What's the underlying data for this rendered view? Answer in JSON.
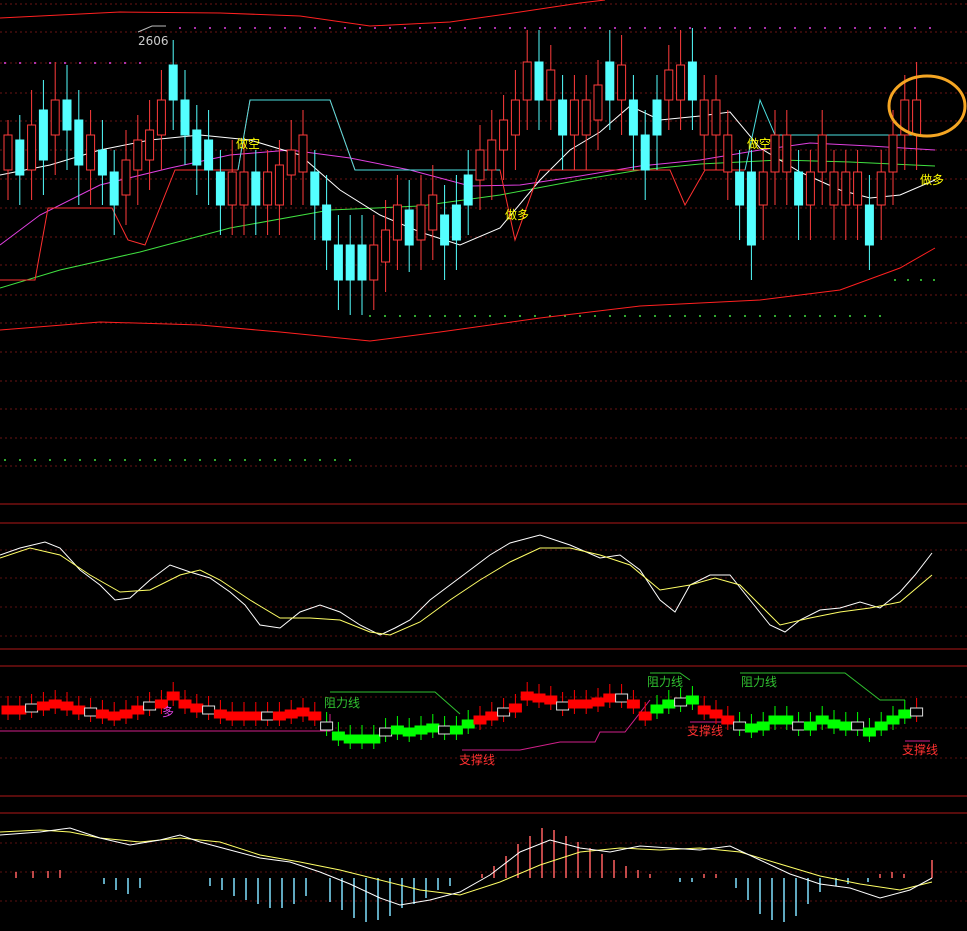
{
  "chart_data": {
    "type": "candlestick",
    "panels": [
      {
        "id": "main",
        "price_label": "2606",
        "annotations": [
          "做空",
          "做多",
          "做空",
          "做多"
        ],
        "colors": {
          "up_candle": "#ff3b3b",
          "down_candle": "#54ffff",
          "ma_white": "#ffffff",
          "ma_magenta": "#e040e0",
          "ma_green": "#40e040",
          "band": "#ff2020",
          "stop_line_red": "#ff3030",
          "stop_line_cyan": "#4de0e0",
          "highlight_circle": "#f5a623",
          "annotation_text": "#ffff00"
        }
      },
      {
        "id": "kdj",
        "series": [
          "fast",
          "slow"
        ],
        "colors": {
          "fast": "#ffffff",
          "slow": "#ffff66"
        }
      },
      {
        "id": "trend-bars",
        "labels": [
          "多",
          "阻力线",
          "支撑线",
          "阻力线",
          "阻力线",
          "支撑线",
          "支撑线"
        ],
        "colors": {
          "up": "#ff0000",
          "down": "#00ff00",
          "resistance": "#30c030",
          "support": "#d0208a",
          "label_red": "#ff3030"
        }
      },
      {
        "id": "macd",
        "series": [
          "DIF",
          "DEA"
        ],
        "colors": {
          "dif": "#ffffff",
          "dea": "#ffff66",
          "pos_bar": "#ff6060",
          "neg_bar": "#7fe0ff"
        }
      }
    ]
  }
}
